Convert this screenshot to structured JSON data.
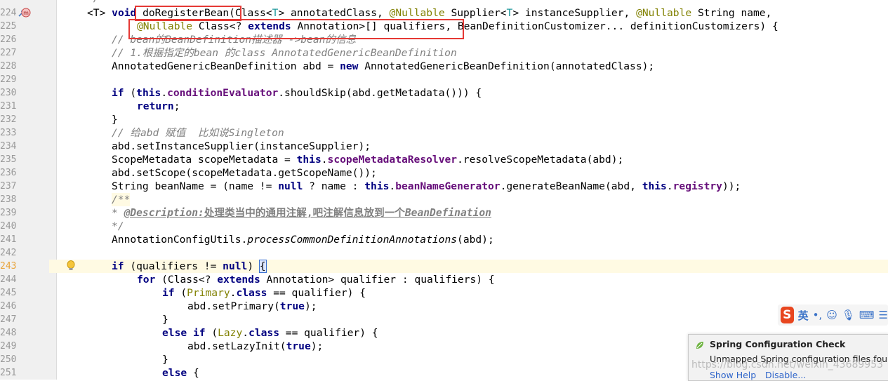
{
  "editor": {
    "line_numbers": [
      "224",
      "225",
      "226",
      "227",
      "228",
      "229",
      "230",
      "231",
      "232",
      "233",
      "234",
      "235",
      "236",
      "237",
      "238",
      "239",
      "240",
      "241",
      "242",
      "243",
      "244",
      "245",
      "246",
      "247",
      "248",
      "249",
      "250",
      "251"
    ],
    "partial_prev_line": "*/"
  },
  "code": {
    "l224": {
      "t": "<T>",
      "void": "void",
      "name": "doRegisterBean",
      "open": "(Class<",
      "T1": "T",
      "p1": "> annotatedClass, ",
      "nullable1": "@Nullable",
      "p2": " Supplier<",
      "T2": "T",
      "p3": "> instanceSupplier, ",
      "nullable2": "@Nullable",
      "p4": " String name,"
    },
    "l225": {
      "nullable": "@Nullable",
      "p1": " Class<? ",
      "extends": "extends",
      "p2": " Annotation>[] qualifiers, BeanDefinitionCustomizer... definitionCustomizers) {"
    },
    "l226": "// bean的BeanDefinition描述器 ->bean的信息",
    "l227": "// 1.根据指定的bean 的class AnnotatedGenericBeanDefinition",
    "l228": {
      "p1": "AnnotatedGenericBeanDefinition abd = ",
      "new": "new",
      "p2": " AnnotatedGenericBeanDefinition(annotatedClass);"
    },
    "l230": {
      "if": "if",
      "p1": " (",
      "this": "this",
      "dot": ".",
      "field": "conditionEvaluator",
      "p2": ".shouldSkip(abd.getMetadata())) {"
    },
    "l231": {
      "return": "return",
      "p": ";"
    },
    "l232": "}",
    "l233": "// 给abd 赋值  比如说Singleton",
    "l234": "abd.setInstanceSupplier(instanceSupplier);",
    "l235": {
      "p1": "ScopeMetadata scopeMetadata = ",
      "this": "this",
      "dot": ".",
      "field": "scopeMetadataResolver",
      "p2": ".resolveScopeMetadata(abd);"
    },
    "l236": "abd.setScope(scopeMetadata.getScopeName());",
    "l237": {
      "p1": "String beanName = (name != ",
      "null": "null",
      "p2": " ? name : ",
      "this1": "this",
      "dot1": ".",
      "field1": "beanNameGenerator",
      "p3": ".generateBeanName(abd, ",
      "this2": "this",
      "dot2": ".",
      "field2": "registry",
      "p4": "));"
    },
    "l238": "/**",
    "l239": {
      "star": "* ",
      "tag": "@Description:",
      "text": "处理类当中的通用注解,吧注解信息放到一个",
      "it": "BeanDefination"
    },
    "l240": "*/",
    "l241": {
      "cls": "AnnotationConfigUtils.",
      "method": "processCommonDefinitionAnnotations",
      "p": "(abd);"
    },
    "l243": {
      "if": "if",
      "p1": " (qualifiers != ",
      "null": "null",
      "p2": ") ",
      "brace": "{"
    },
    "l244": {
      "for": "for",
      "p1": " (Class<? ",
      "extends": "extends",
      "p2": " Annotation> qualifier : qualifiers) {"
    },
    "l245": {
      "if": "if",
      "p1": " (",
      "cls": "Primary",
      "dot": ".",
      "class": "class",
      "p2": " == qualifier) {"
    },
    "l246": {
      "p1": "abd.setPrimary(",
      "true": "true",
      "p2": ");"
    },
    "l247": "}",
    "l248": {
      "else": "else",
      "sp": " ",
      "if": "if",
      "p1": " (",
      "cls": "Lazy",
      "dot": ".",
      "class": "class",
      "p2": " == qualifier) {"
    },
    "l249": {
      "p1": "abd.setLazyInit(",
      "true": "true",
      "p2": ");"
    },
    "l250": "}",
    "l251": {
      "else": "else",
      "p": " {"
    }
  },
  "ime_toolbar": {
    "logo": "S",
    "mode": "英",
    "punct": "•,",
    "emoji": "☺",
    "mic": "🎙",
    "keyboard": "⌨",
    "more": "☰"
  },
  "notification": {
    "title": "Spring Configuration Check",
    "body": "Unmapped Spring configuration files found.",
    "show_help": "Show Help",
    "disable": "Disable..."
  },
  "watermark": "https://blog.csdn.net/weixin_43689953",
  "colors": {
    "keyword": "#000080",
    "field": "#660e7a",
    "annotation": "#808000",
    "comment": "#808080",
    "highlight_box": "#e53935",
    "current_line": "#fffae3"
  }
}
